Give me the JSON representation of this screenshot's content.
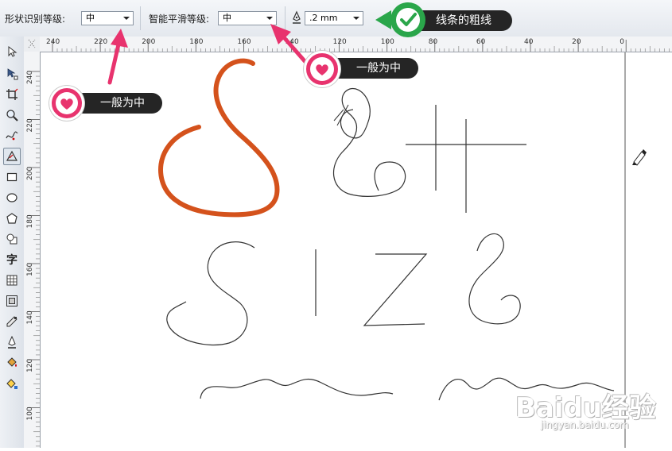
{
  "property_bar": {
    "shape_recognition_label": "形状识别等级:",
    "shape_recognition_value": "中",
    "smart_smoothing_label": "智能平滑等级:",
    "smart_smoothing_value": "中",
    "outline_width_value": ".2 mm"
  },
  "ruler_h_ticks": [
    "240",
    "220",
    "200",
    "180",
    "160",
    "140",
    "120",
    "100",
    "80",
    "60",
    "40",
    "20",
    "0"
  ],
  "ruler_v_ticks": [
    "240",
    "220",
    "200",
    "180",
    "160",
    "140",
    "120",
    "100"
  ],
  "toolbox": {
    "tools": [
      "pick-tool-icon",
      "shape-tool-icon",
      "crop-tool-icon",
      "zoom-tool-icon",
      "freehand-tool-icon",
      "smart-drawing-tool-icon",
      "rectangle-tool-icon",
      "ellipse-tool-icon",
      "polygon-tool-icon",
      "basic-shapes-tool-icon",
      "text-tool-icon",
      "table-tool-icon",
      "contour-tool-icon",
      "eyedropper-tool-icon",
      "outline-pen-tool-icon",
      "fill-tool-icon",
      "interactive-fill-tool-icon"
    ],
    "text_tool_glyph": "字"
  },
  "annotations": {
    "callout_1": "一般为中",
    "callout_2": "一般为中",
    "callout_3": "线条的粗线"
  },
  "watermark": {
    "brand": "Baidu经验",
    "url": "jingyan.baidu.com"
  },
  "colors": {
    "orange_stroke": "#d4521c",
    "callout_pink": "#e8336e",
    "callout_green": "#2aa64a"
  }
}
